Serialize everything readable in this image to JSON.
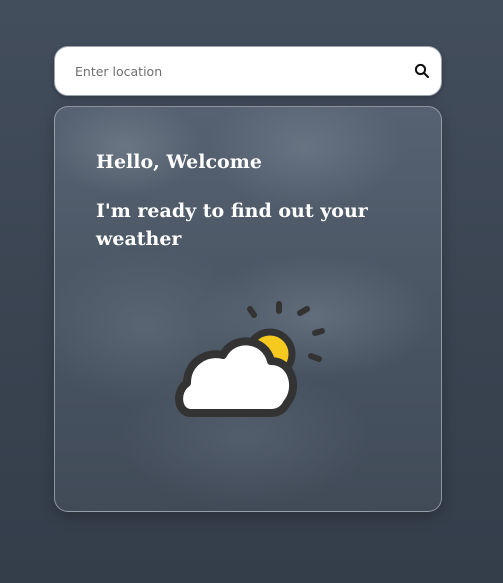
{
  "search": {
    "placeholder": "Enter location",
    "value": ""
  },
  "card": {
    "greeting": "Hello, Welcome",
    "message": "I'm ready to find out your weather",
    "illustration": "partly-cloudy-icon"
  },
  "colors": {
    "background": "#3a4451",
    "sun": "#f6c91f",
    "cloud_outline": "#333333",
    "cloud_fill": "#ffffff",
    "text": "#ffffff"
  }
}
